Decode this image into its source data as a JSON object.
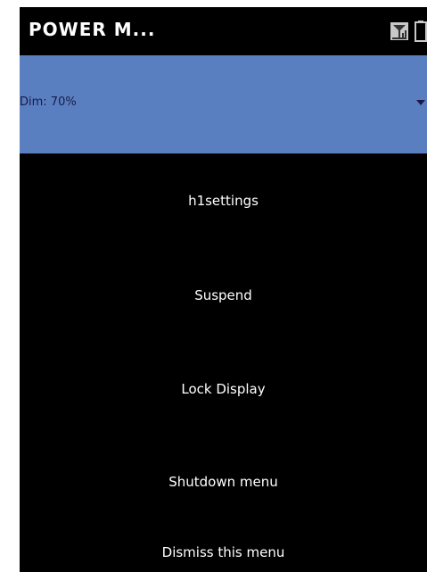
{
  "window": {
    "title": "POWER M..."
  },
  "status": {
    "signal_icon": "signal-icon",
    "battery_icon": "battery-icon"
  },
  "dim": {
    "label": "Dim: 70%",
    "value_percent": 70
  },
  "menu": {
    "items": [
      {
        "label": "h1settings"
      },
      {
        "label": "Suspend"
      },
      {
        "label": "Lock Display"
      },
      {
        "label": "Shutdown menu"
      },
      {
        "label": "Dismiss this menu"
      }
    ]
  },
  "colors": {
    "background": "#000000",
    "dim_bar": "#5a7fc0",
    "text": "#ffffff"
  }
}
